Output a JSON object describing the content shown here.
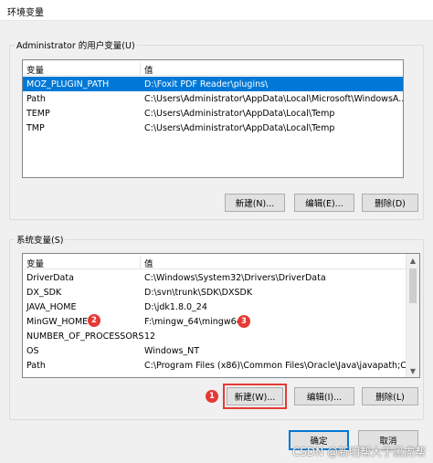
{
  "window": {
    "title": "环境变量"
  },
  "user_vars": {
    "group_label": "Administrator 的用户变量(U)",
    "col_var": "变量",
    "col_val": "值",
    "rows": [
      {
        "name": "MOZ_PLUGIN_PATH",
        "value": "D:\\Foxit PDF Reader\\plugins\\",
        "selected": true
      },
      {
        "name": "Path",
        "value": "C:\\Users\\Administrator\\AppData\\Local\\Microsoft\\WindowsA..."
      },
      {
        "name": "TEMP",
        "value": "C:\\Users\\Administrator\\AppData\\Local\\Temp"
      },
      {
        "name": "TMP",
        "value": "C:\\Users\\Administrator\\AppData\\Local\\Temp"
      }
    ],
    "buttons": {
      "new": "新建(N)...",
      "edit": "编辑(E)...",
      "delete": "删除(D)"
    }
  },
  "system_vars": {
    "group_label": "系统变量(S)",
    "col_var": "变量",
    "col_val": "值",
    "rows": [
      {
        "name": "DriverData",
        "value": "C:\\Windows\\System32\\Drivers\\DriverData"
      },
      {
        "name": "DX_SDK",
        "value": "D:\\svn\\trunk\\SDK\\DXSDK"
      },
      {
        "name": "JAVA_HOME",
        "value": "D:\\jdk1.8.0_24"
      },
      {
        "name": "MinGW_HOME",
        "value": "F:\\mingw_64\\mingw64"
      },
      {
        "name": "NUMBER_OF_PROCESSORS",
        "value": "12"
      },
      {
        "name": "OS",
        "value": "Windows_NT"
      },
      {
        "name": "Path",
        "value": "C:\\Program Files (x86)\\Common Files\\Oracle\\Java\\javapath;C:..."
      }
    ],
    "buttons": {
      "new": "新建(W)...",
      "edit": "编辑(I)...",
      "delete": "删除(L)"
    }
  },
  "footer": {
    "ok": "确定",
    "cancel": "取消"
  },
  "annotations": {
    "m1": "1",
    "m2": "2",
    "m3": "3"
  },
  "watermark": "CSDN @新明帮大于黑虎帮",
  "colors": {
    "selection": "#0078d7",
    "annotation": "#e53935"
  }
}
